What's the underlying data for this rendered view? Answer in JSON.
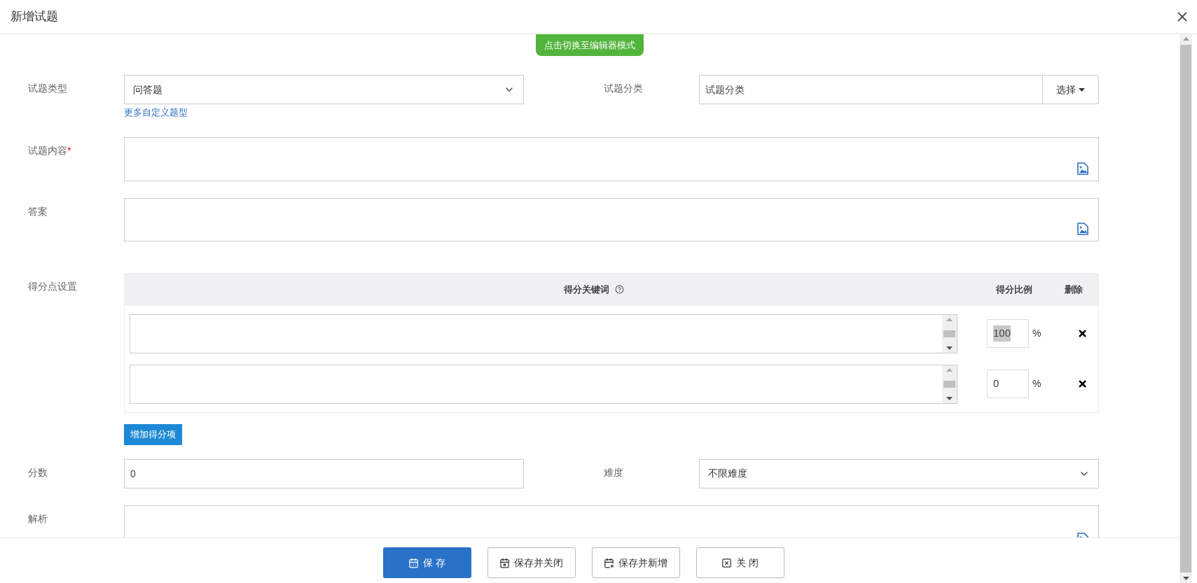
{
  "dialog": {
    "title": "新增试题"
  },
  "mode_button": "点击切换至编辑器模式",
  "question_type": {
    "label": "试题类型",
    "value": "问答题",
    "link": "更多自定义题型"
  },
  "category": {
    "label": "试题分类",
    "placeholder": "试题分类",
    "button": "选择"
  },
  "content": {
    "label": "试题内容",
    "required_mark": "*"
  },
  "answer": {
    "label": "答案"
  },
  "scoring": {
    "label": "得分点设置",
    "columns": [
      "得分关键词",
      "得分比例",
      "删除"
    ],
    "rows": [
      {
        "ratio": "100",
        "ratio_highlighted": true,
        "unit": "%"
      },
      {
        "ratio": "0",
        "ratio_highlighted": false,
        "unit": "%"
      }
    ],
    "add_button": "增加得分项"
  },
  "score": {
    "label": "分数",
    "value": "0"
  },
  "difficulty": {
    "label": "难度",
    "value": "不限难度"
  },
  "analysis": {
    "label": "解析"
  },
  "footer_buttons": [
    {
      "label": "保 存",
      "kind": "primary"
    },
    {
      "label": "保存并关闭",
      "kind": "save-close"
    },
    {
      "label": "保存并新增",
      "kind": "save-new"
    },
    {
      "label": "关 闭",
      "kind": "close"
    }
  ]
}
